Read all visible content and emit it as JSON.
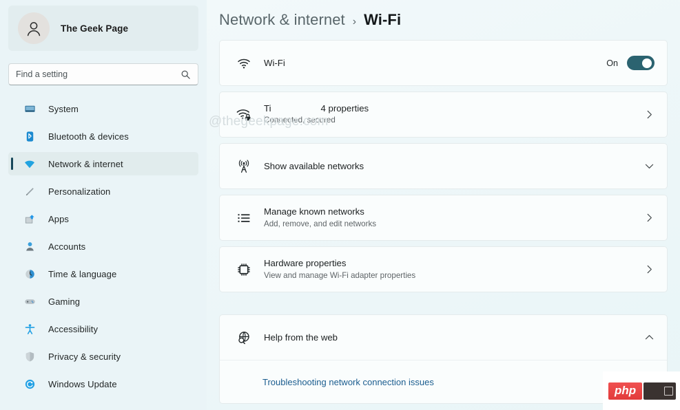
{
  "sidebar": {
    "account": {
      "name": "The Geek Page",
      "avatar_icon": "user-avatar-icon"
    },
    "search": {
      "placeholder": "Find a setting",
      "value": "",
      "icon": "search-icon"
    },
    "items": [
      {
        "label": "System",
        "icon": "monitor-icon",
        "selected": false
      },
      {
        "label": "Bluetooth & devices",
        "icon": "bluetooth-icon",
        "selected": false
      },
      {
        "label": "Network & internet",
        "icon": "wifi-icon",
        "selected": true
      },
      {
        "label": "Personalization",
        "icon": "paintbrush-icon",
        "selected": false
      },
      {
        "label": "Apps",
        "icon": "apps-icon",
        "selected": false
      },
      {
        "label": "Accounts",
        "icon": "accounts-icon",
        "selected": false
      },
      {
        "label": "Time & language",
        "icon": "clock-icon",
        "selected": false
      },
      {
        "label": "Gaming",
        "icon": "gamepad-icon",
        "selected": false
      },
      {
        "label": "Accessibility",
        "icon": "accessibility-icon",
        "selected": false
      },
      {
        "label": "Privacy & security",
        "icon": "shield-icon",
        "selected": false
      },
      {
        "label": "Windows Update",
        "icon": "update-icon",
        "selected": false
      }
    ]
  },
  "breadcrumb": {
    "parent": "Network & internet",
    "separator": "›",
    "current": "Wi-Fi"
  },
  "watermark": "@thegeekpage.com",
  "main": {
    "wifi_toggle_row": {
      "title": "Wi-Fi",
      "icon": "wifi-icon",
      "state_label": "On",
      "state_on": true,
      "accent_color": "#2b6370"
    },
    "network_row": {
      "ssid": "Ti",
      "properties_label": "4 properties",
      "status": "Connected, secured",
      "icon": "wifi-lock-icon",
      "chevron": "chevron-right-icon"
    },
    "show_networks_row": {
      "title": "Show available networks",
      "icon": "broadcast-tower-icon",
      "chevron": "chevron-down-icon"
    },
    "manage_networks_row": {
      "title": "Manage known networks",
      "subtitle": "Add, remove, and edit networks",
      "icon": "list-icon",
      "chevron": "chevron-right-icon"
    },
    "hardware_row": {
      "title": "Hardware properties",
      "subtitle": "View and manage Wi-Fi adapter properties",
      "icon": "chip-icon",
      "chevron": "chevron-right-icon"
    },
    "help_section": {
      "title": "Help from the web",
      "icon": "globe-search-icon",
      "chevron": "chevron-up-icon",
      "links": [
        {
          "label": "Troubleshooting network connection issues"
        }
      ]
    }
  },
  "badge": {
    "text": "php",
    "color": "#e23b3b"
  }
}
